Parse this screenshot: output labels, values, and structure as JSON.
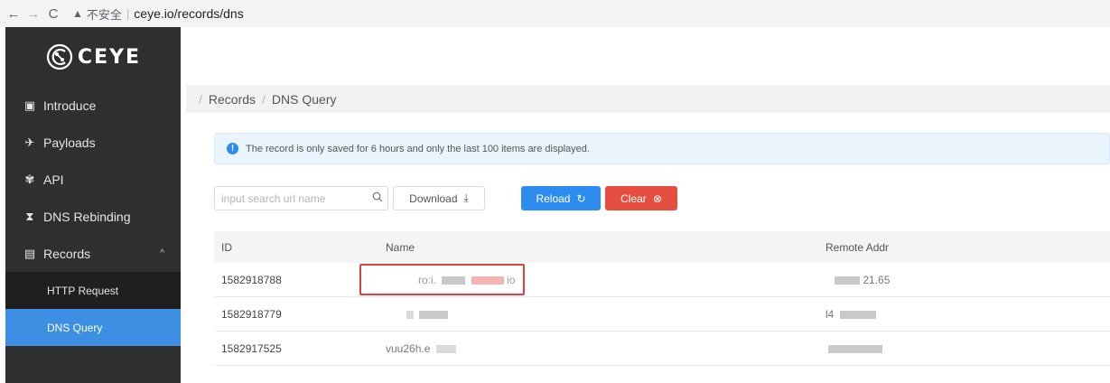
{
  "browser": {
    "back_icon": "←",
    "forward_icon": "→",
    "reload_icon": "C",
    "warning_icon": "▲",
    "security_label": "不安全",
    "separator": "|",
    "url": "ceye.io/records/dns"
  },
  "sidebar": {
    "logo_text": "CEYE",
    "items": [
      {
        "icon": "document-icon",
        "glyph": "▣",
        "label": "Introduce"
      },
      {
        "icon": "rocket-icon",
        "glyph": "✈",
        "label": "Payloads"
      },
      {
        "icon": "api-icon",
        "glyph": "✾",
        "label": "API"
      },
      {
        "icon": "hourglass-icon",
        "glyph": "⧗",
        "label": "DNS Rebinding"
      },
      {
        "icon": "list-icon",
        "glyph": "▤",
        "label": "Records",
        "expanded": true,
        "caret": "^"
      }
    ],
    "sub_items": [
      {
        "label": "HTTP Request",
        "active": false
      },
      {
        "label": "DNS Query",
        "active": true
      }
    ]
  },
  "breadcrumb": {
    "items": [
      "Records",
      "DNS Query"
    ]
  },
  "alert": {
    "icon": "info-icon",
    "glyph": "!",
    "text": "The record is only saved for 6 hours and only the last 100 items are displayed."
  },
  "toolbar": {
    "search_placeholder": "input search url name",
    "search_value": "",
    "download_label": "Download",
    "download_icon": "⤓",
    "reload_label": "Reload",
    "reload_icon": "↻",
    "clear_label": "Clear",
    "clear_icon": "⊗"
  },
  "table": {
    "headers": [
      "ID",
      "Name",
      "Remote Addr"
    ],
    "rows": [
      {
        "id": "1582918788",
        "name": "ro:i.",
        "name_tail": "io",
        "addr": "21.65"
      },
      {
        "id": "1582918779",
        "name": "",
        "name_tail": "",
        "addr": "l4"
      },
      {
        "id": "1582917525",
        "name": "vuu26h.e",
        "name_tail": "",
        "addr": ""
      }
    ]
  },
  "colors": {
    "sidebar_bg": "#2f2f2f",
    "active_item": "#3d8fe3",
    "reload_button": "#2d8cf0",
    "clear_button": "#e54d3f",
    "highlight_box": "#e04040"
  }
}
